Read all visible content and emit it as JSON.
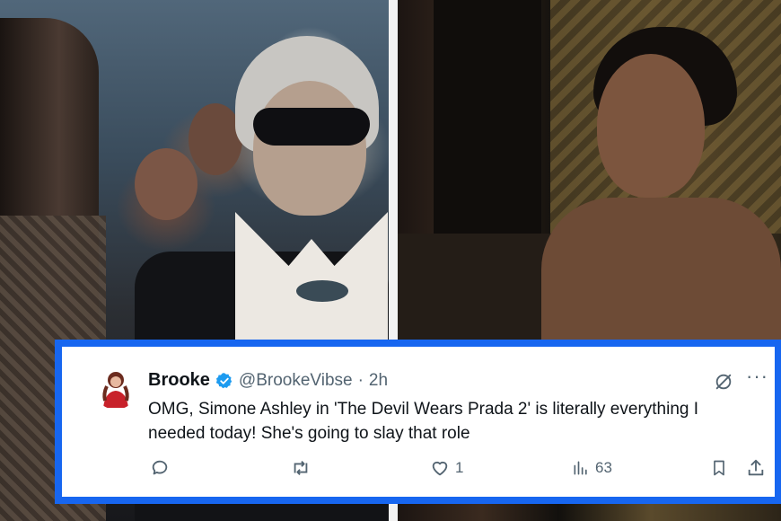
{
  "tweet": {
    "author_name": "Brooke",
    "handle": "@BrookeVibse",
    "separator": "·",
    "time": "2h",
    "text": "OMG, Simone Ashley in 'The Devil Wears Prada 2' is literally everything I needed today! She's going to slay that role",
    "likes": "1",
    "views": "63",
    "verified": true
  },
  "colors": {
    "frame": "#1766f0",
    "verified_badge": "#1d9bf0",
    "secondary_text": "#536471",
    "primary_text": "#0f1419"
  },
  "icons": [
    "verified-badge-icon",
    "grok-icon",
    "more-icon",
    "reply-icon",
    "retweet-icon",
    "like-icon",
    "views-icon",
    "bookmark-icon",
    "share-icon"
  ]
}
